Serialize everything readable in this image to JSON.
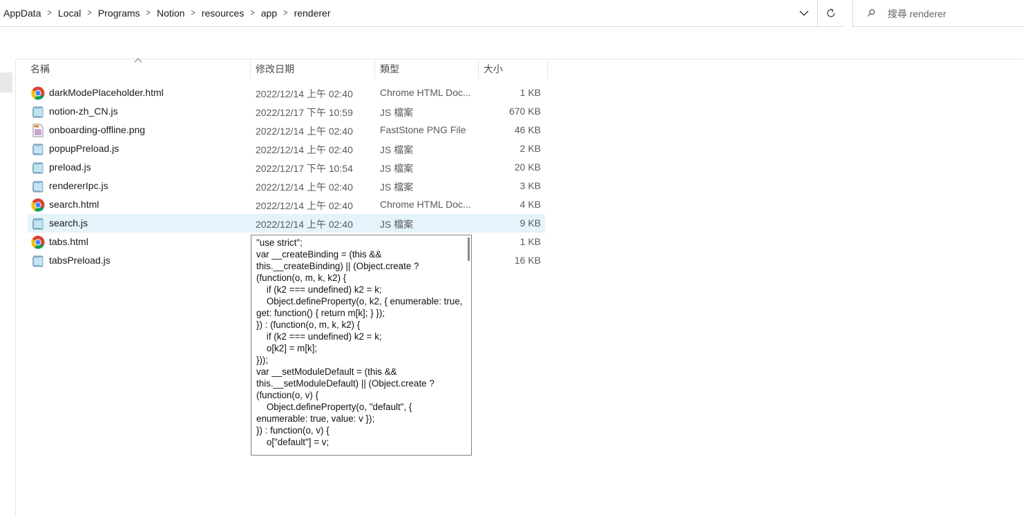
{
  "breadcrumb": [
    "AppData",
    "Local",
    "Programs",
    "Notion",
    "resources",
    "app",
    "renderer"
  ],
  "breadcrumb_separator": ">",
  "search": {
    "placeholder": "搜尋 renderer"
  },
  "columns": {
    "name": "名稱",
    "modified": "修改日期",
    "type": "類型",
    "size": "大小"
  },
  "files": [
    {
      "name": "darkModePlaceholder.html",
      "date": "2022/12/14 上午 02:40",
      "type": "Chrome HTML Doc...",
      "size": "1 KB",
      "icon": "chrome-icon"
    },
    {
      "name": "notion-zh_CN.js",
      "date": "2022/12/17 下午 10:59",
      "type": "JS 檔案",
      "size": "670 KB",
      "icon": "js-file-icon"
    },
    {
      "name": "onboarding-offline.png",
      "date": "2022/12/14 上午 02:40",
      "type": "FastStone PNG File",
      "size": "46 KB",
      "icon": "png-file-icon"
    },
    {
      "name": "popupPreload.js",
      "date": "2022/12/14 上午 02:40",
      "type": "JS 檔案",
      "size": "2 KB",
      "icon": "js-file-icon"
    },
    {
      "name": "preload.js",
      "date": "2022/12/17 下午 10:54",
      "type": "JS 檔案",
      "size": "20 KB",
      "icon": "js-file-icon"
    },
    {
      "name": "rendererIpc.js",
      "date": "2022/12/14 上午 02:40",
      "type": "JS 檔案",
      "size": "3 KB",
      "icon": "js-file-icon"
    },
    {
      "name": "search.html",
      "date": "2022/12/14 上午 02:40",
      "type": "Chrome HTML Doc...",
      "size": "4 KB",
      "icon": "chrome-icon"
    },
    {
      "name": "search.js",
      "date": "2022/12/14 上午 02:40",
      "type": "JS 檔案",
      "size": "9 KB",
      "icon": "js-file-icon",
      "selected": true
    },
    {
      "name": "tabs.html",
      "date": "",
      "type": "",
      "size": "1 KB",
      "icon": "chrome-icon"
    },
    {
      "name": "tabsPreload.js",
      "date": "",
      "type": "",
      "size": "16 KB",
      "icon": "js-file-icon"
    }
  ],
  "preview": {
    "text": "\"use strict\";\nvar __createBinding = (this && this.__createBinding) || (Object.create ? (function(o, m, k, k2) {\n    if (k2 === undefined) k2 = k;\n    Object.defineProperty(o, k2, { enumerable: true, get: function() { return m[k]; } });\n}) : (function(o, m, k, k2) {\n    if (k2 === undefined) k2 = k;\n    o[k2] = m[k];\n}));\nvar __setModuleDefault = (this && this.__setModuleDefault) || (Object.create ? (function(o, v) {\n    Object.defineProperty(o, \"default\", { enumerable: true, value: v });\n}) : function(o, v) {\n    o[\"default\"] = v;"
  },
  "colors": {
    "selection": "#e5f3fb",
    "border": "#e5e5e5",
    "chrome_red": "#db4437",
    "chrome_yellow": "#f4c20d",
    "chrome_green": "#0f9d58",
    "chrome_blue": "#4285f4"
  }
}
